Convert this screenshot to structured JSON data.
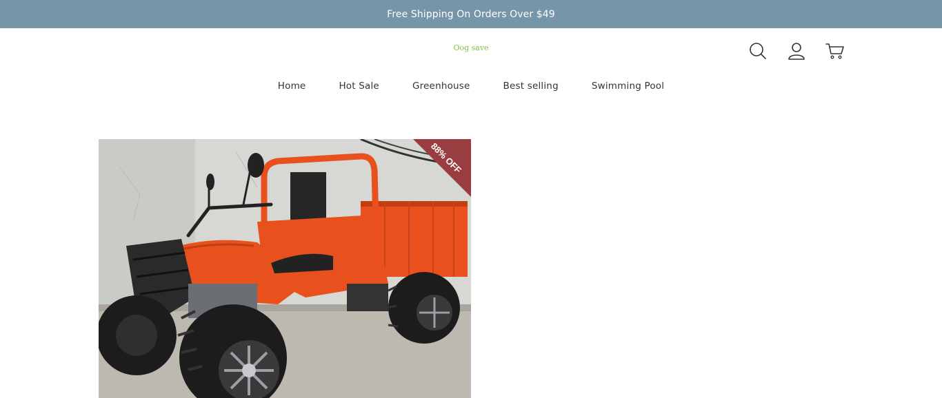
{
  "announcement": {
    "text": "Free Shipping On Orders Over $49",
    "background": "#7695a8"
  },
  "header": {
    "logo_text": "Oog save",
    "logo_color": "#7bc142",
    "icons": [
      "search-icon",
      "account-icon",
      "cart-icon"
    ]
  },
  "nav": {
    "items": [
      {
        "label": "Home"
      },
      {
        "label": "Hot Sale"
      },
      {
        "label": "Greenhouse"
      },
      {
        "label": "Best selling"
      },
      {
        "label": "Swimming Pool"
      }
    ]
  },
  "product": {
    "badge_text": "88% OFF",
    "badge_color": "#9a3d40",
    "vehicle_color": "#e8501e"
  }
}
